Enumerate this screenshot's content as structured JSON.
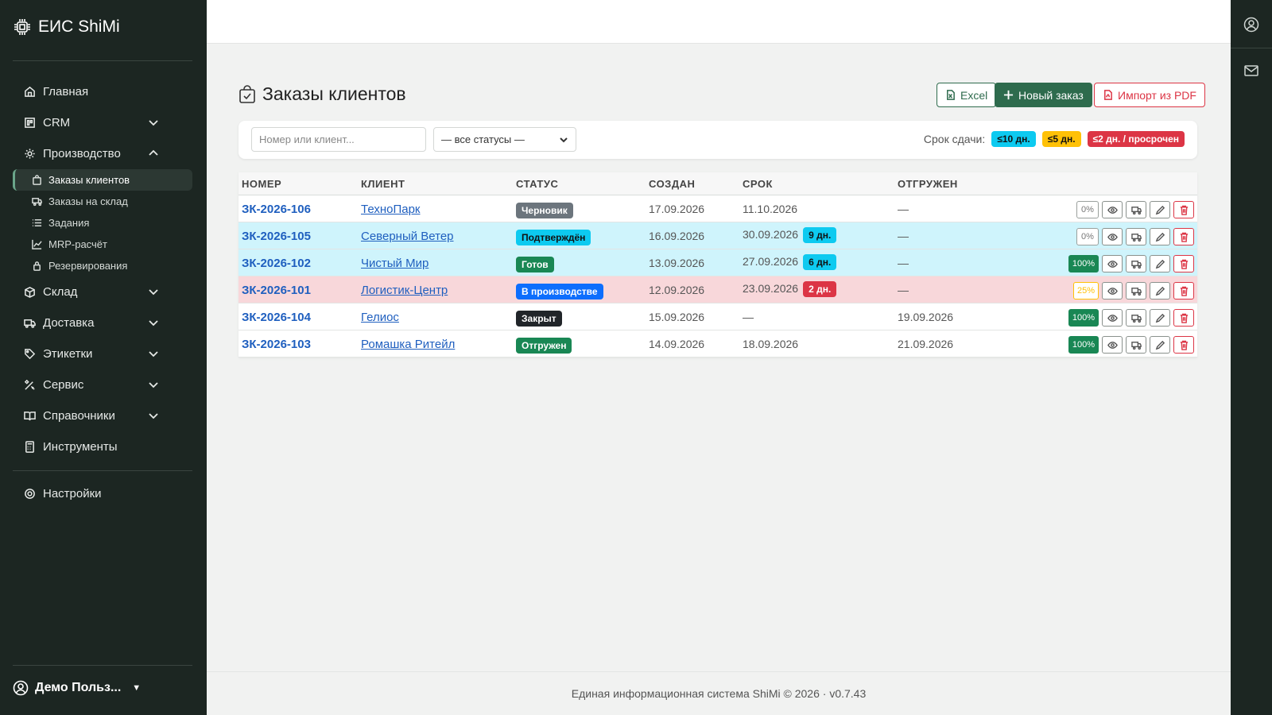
{
  "app": {
    "brand": "ЕИС ShiMi"
  },
  "sidebar": {
    "items": [
      {
        "label": "Главная",
        "icon": "home-icon"
      },
      {
        "label": "CRM",
        "icon": "crm-icon"
      },
      {
        "label": "Производство",
        "icon": "gear-icon"
      },
      {
        "label": "Склад",
        "icon": "box-icon"
      },
      {
        "label": "Доставка",
        "icon": "truck-icon"
      },
      {
        "label": "Этикетки",
        "icon": "tag-icon"
      },
      {
        "label": "Сервис",
        "icon": "tools-icon"
      },
      {
        "label": "Справочники",
        "icon": "book-icon"
      },
      {
        "label": "Инструменты",
        "icon": "calculator-icon"
      },
      {
        "label": "Настройки",
        "icon": "settings-icon"
      }
    ],
    "sub": [
      {
        "label": "Заказы клиентов",
        "icon": "bag-icon",
        "active": true
      },
      {
        "label": "Заказы на склад",
        "icon": "truck-icon"
      },
      {
        "label": "Задания",
        "icon": "list-icon"
      },
      {
        "label": "MRP-расчёт",
        "icon": "chart-icon"
      },
      {
        "label": "Резервирования",
        "icon": "lock-icon"
      }
    ],
    "user": "Демо Польз..."
  },
  "page": {
    "title": "Заказы клиентов",
    "buttons": {
      "excel": "Excel",
      "new_order": "Новый заказ",
      "import_pdf": "Импорт из PDF"
    }
  },
  "filters": {
    "search_placeholder": "Номер или клиент...",
    "status_selected": "— все статусы —",
    "deadline_label": "Срок сдачи:",
    "legend": {
      "le10": "≤10 дн.",
      "le5": "≤5 дн.",
      "le2": "≤2 дн. / просрочен"
    }
  },
  "table": {
    "headers": {
      "num": "НОМЕР",
      "client": "КЛИЕНТ",
      "status": "СТАТУС",
      "created": "СОЗДАН",
      "due": "СРОК",
      "shipped": "ОТГРУЖЕН"
    },
    "rows": [
      {
        "num": "ЗК-2026-106",
        "client": "ТехноПарк",
        "status": "Черновик",
        "created": "17.09.2026",
        "due": "11.10.2026",
        "days": "",
        "shipped": "—",
        "progress": "0%"
      },
      {
        "num": "ЗК-2026-105",
        "client": "Северный Ветер",
        "status": "Подтверждён",
        "created": "16.09.2026",
        "due": "30.09.2026",
        "days": "9 дн.",
        "shipped": "—",
        "progress": "0%"
      },
      {
        "num": "ЗК-2026-102",
        "client": "Чистый Мир",
        "status": "Готов",
        "created": "13.09.2026",
        "due": "27.09.2026",
        "days": "6 дн.",
        "shipped": "—",
        "progress": "100%"
      },
      {
        "num": "ЗК-2026-101",
        "client": "Логистик-Центр",
        "status": "В производстве",
        "created": "12.09.2026",
        "due": "23.09.2026",
        "days": "2 дн.",
        "shipped": "—",
        "progress": "25%"
      },
      {
        "num": "ЗК-2026-104",
        "client": "Гелиос",
        "status": "Закрыт",
        "created": "15.09.2026",
        "due": "—",
        "days": "",
        "shipped": "19.09.2026",
        "progress": "100%"
      },
      {
        "num": "ЗК-2026-103",
        "client": "Ромашка Ритейл",
        "status": "Отгружен",
        "created": "14.09.2026",
        "due": "18.09.2026",
        "days": "",
        "shipped": "21.09.2026",
        "progress": "100%"
      }
    ]
  },
  "footer": {
    "text": "Единая информационная система ShiMi © 2026 · v0.7.43"
  },
  "colors": {
    "sidebar_bg": "#1c2622",
    "primary": "#2e6b4d",
    "link": "#1f5fbf",
    "danger": "#dc3545",
    "info": "#0dcaf0",
    "warning": "#ffc107",
    "success": "#198754"
  }
}
